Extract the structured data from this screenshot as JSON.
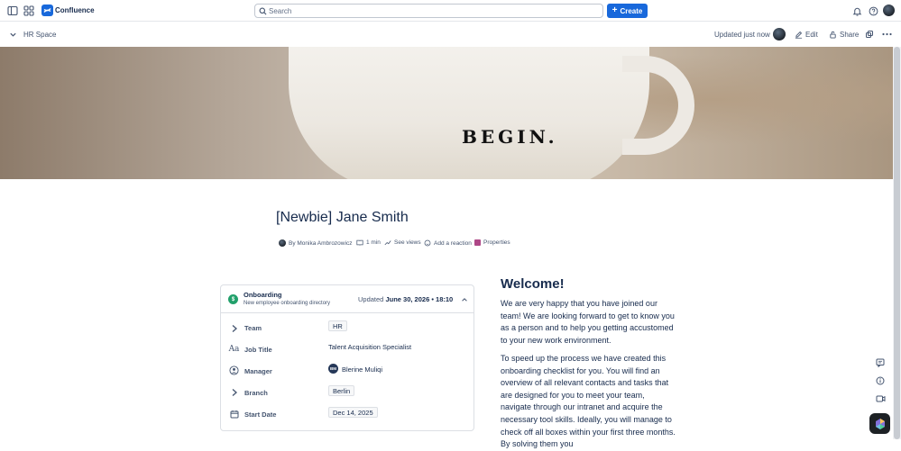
{
  "topbar": {
    "app_name": "Confluence",
    "search_placeholder": "Search",
    "create_label": "Create"
  },
  "subbar": {
    "breadcrumb": "HR Space",
    "updated": "Updated just now",
    "edit_label": "Edit",
    "share_label": "Share"
  },
  "banner": {
    "mug_text": "BEGIN."
  },
  "page": {
    "title": "[Newbie] Jane Smith",
    "meta": {
      "author": "By Monika Ambrozowicz",
      "read_time": "1 min",
      "views": "See views",
      "reaction": "Add a reaction",
      "properties": "Properties"
    }
  },
  "card": {
    "title": "Onboarding",
    "subtitle": "New employee onboarding directory",
    "updated_prefix": "Updated",
    "updated_date": "June 30, 2026 • 18:10",
    "rows": [
      {
        "label": "Team",
        "value": "HR"
      },
      {
        "label": "Job Title",
        "value": "Talent Acquisition Specialist"
      },
      {
        "label": "Manager",
        "value": "Blerine Muliqi",
        "initials": "BM"
      },
      {
        "label": "Branch",
        "value": "Berlin"
      },
      {
        "label": "Start Date",
        "value": "Dec 14, 2025"
      }
    ]
  },
  "content": {
    "heading": "Welcome!",
    "para1": "We are very happy that you have joined our team! We are looking forward to get to know you as a person and to help you getting accustomed to your new work environment.",
    "para2": "To speed up the process we have created this onboarding checklist for you. You will find an overview of all relevant contacts and tasks that are designed for you to meet your team, navigate through our intranet and acquire the necessary tool skills. Ideally, you will manage to check off all boxes within your first three months. By solving them you"
  },
  "colors": {
    "accent": "#1868db",
    "success": "#22a06b"
  }
}
